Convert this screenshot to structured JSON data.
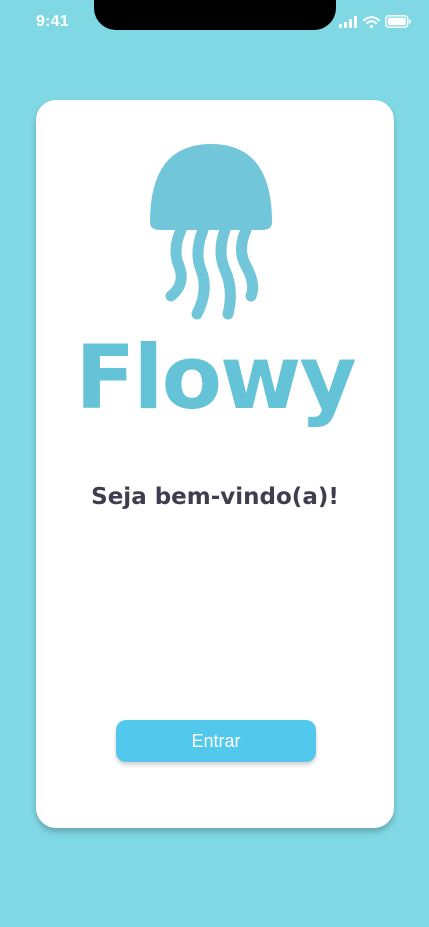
{
  "status_bar": {
    "time": "9:41",
    "icons": [
      "signal-icon",
      "wifi-icon",
      "battery-icon"
    ]
  },
  "brand": {
    "logo": "jellyfish-icon",
    "name": "Flowy",
    "color": "#64C3D6"
  },
  "welcome": {
    "text": "Seja bem-vindo(a)!"
  },
  "actions": {
    "enter_label": "Entrar",
    "enter_color": "#52C8EC"
  },
  "theme": {
    "background": "#80D8E4",
    "card": "#FFFFFF",
    "text": "#3E3E4E"
  }
}
